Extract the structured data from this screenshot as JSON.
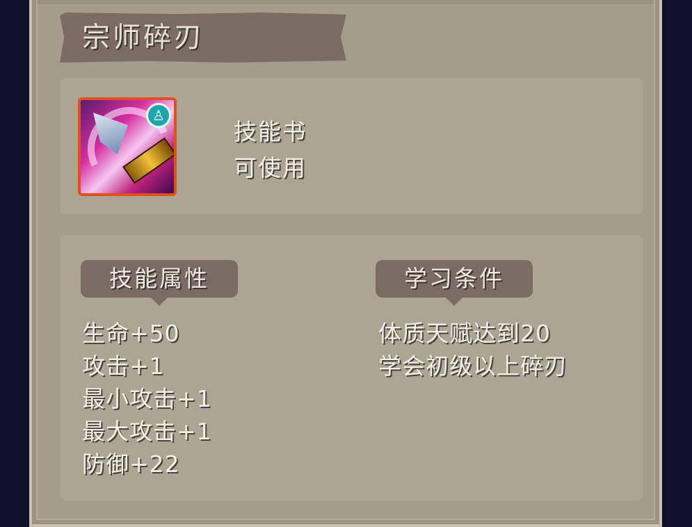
{
  "skill": {
    "title": "宗师碎刃",
    "type": "技能书",
    "status": "可使用",
    "icon": "skill-shatter-blade-icon",
    "badge_icon": "character-badge-icon"
  },
  "attributes": {
    "heading": "技能属性",
    "items": [
      "生命+50",
      "攻击+1",
      "最小攻击+1",
      "最大攻击+1",
      "防御+22"
    ]
  },
  "requirements": {
    "heading": "学习条件",
    "items": [
      "体质天赋达到20",
      "学会初级以上碎刃"
    ]
  },
  "colors": {
    "panel": "#a49c8c",
    "banner": "#7a6c64",
    "icon_border": "#e0501c",
    "badge": "#1aa7b0"
  }
}
